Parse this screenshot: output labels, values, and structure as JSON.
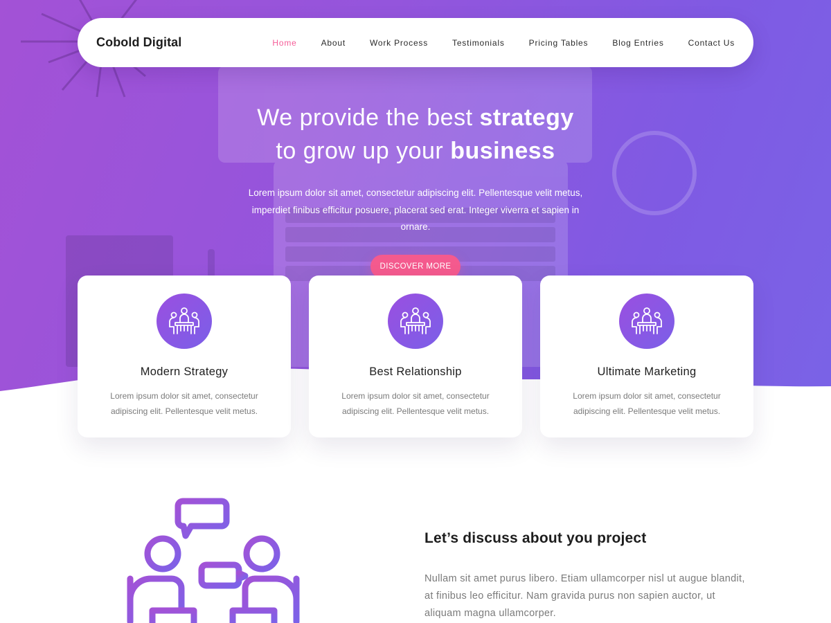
{
  "brand": {
    "name": "Cobold Digital"
  },
  "nav": {
    "items": [
      {
        "label": "Home",
        "active": true
      },
      {
        "label": "About",
        "active": false
      },
      {
        "label": "Work Process",
        "active": false
      },
      {
        "label": "Testimonials",
        "active": false
      },
      {
        "label": "Pricing Tables",
        "active": false
      },
      {
        "label": "Blog Entries",
        "active": false
      },
      {
        "label": "Contact Us",
        "active": false
      }
    ]
  },
  "hero": {
    "line1_pre": "We provide the best ",
    "line1_bold": "strategy",
    "line2_pre": "to grow up your ",
    "line2_bold": "business",
    "lead": "Lorem ipsum dolor sit amet, consectetur adipiscing elit. Pellentesque velit metus, imperdiet finibus efficitur posuere, placerat sed erat. Integer viverra et sapien in ornare.",
    "cta_label": "DISCOVER MORE"
  },
  "features": [
    {
      "title": "Modern Strategy",
      "text": "Lorem ipsum dolor sit amet, consectetur adipiscing elit. Pellentesque velit metus.",
      "icon": "meeting-table-icon"
    },
    {
      "title": "Best Relationship",
      "text": "Lorem ipsum dolor sit amet, consectetur adipiscing elit. Pellentesque velit metus.",
      "icon": "meeting-table-icon"
    },
    {
      "title": "Ultimate Marketing",
      "text": "Lorem ipsum dolor sit amet, consectetur adipiscing elit. Pellentesque velit metus.",
      "icon": "meeting-table-icon"
    }
  ],
  "discuss": {
    "title": "Let’s discuss about you project",
    "text": "Nullam sit amet purus libero. Etiam ullamcorper nisl ut augue blandit, at finibus leo efficitur. Nam gravida purus non sapien auctor, ut aliquam magna ullamcorper.",
    "illustration": "discussion-people-icon"
  },
  "colors": {
    "accent": "#f55c97",
    "cta": "#f45a8e",
    "gradient_start": "#a352d6",
    "gradient_end": "#7a63e6",
    "icon_bg": "#8a57e4"
  }
}
